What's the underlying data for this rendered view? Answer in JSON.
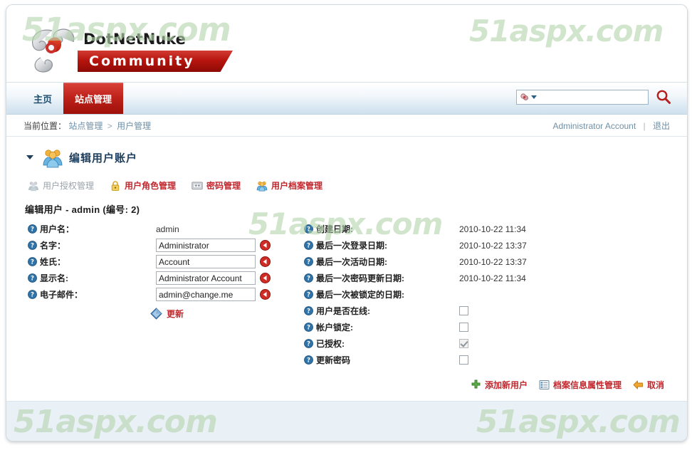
{
  "logo": {
    "line1": "DotNetNuke",
    "line2": "Community",
    "icon": "dnn-swirl-logo"
  },
  "watermarks": {
    "text": "51aspx.com",
    "color": "#b6d6b0"
  },
  "nav": {
    "tabs": [
      {
        "label": "主页",
        "active": false
      },
      {
        "label": "站点管理",
        "active": true
      }
    ]
  },
  "search": {
    "value": "",
    "placeholder": "",
    "provider_icon": "search-provider-icon",
    "dropdown_icon": "chevron-down-icon",
    "go_icon": "magnifier-icon"
  },
  "breadcrumb": {
    "label": "当前位置：",
    "items": [
      "站点管理",
      "用户管理"
    ],
    "separator": ">"
  },
  "account": {
    "name": "Administrator Account",
    "separator": "|",
    "logout": "退出"
  },
  "module": {
    "title": "编辑用户账户",
    "icon": "users-group-icon",
    "collapse_icon": "triangle-down-icon"
  },
  "tablinks": [
    {
      "label": "用户授权管理",
      "icon": "users-group-icon",
      "disabled": true
    },
    {
      "label": "用户角色管理",
      "icon": "lock-icon",
      "disabled": false
    },
    {
      "label": "密码管理",
      "icon": "password-asterisks-icon",
      "disabled": false
    },
    {
      "label": "用户档案管理",
      "icon": "users-group-icon",
      "disabled": false
    }
  ],
  "edit_heading": "编辑用户 - admin (编号: 2)",
  "left_fields": [
    {
      "label": "用户名：",
      "type": "text_static",
      "value": "admin"
    },
    {
      "label": "名字：",
      "type": "input",
      "value": "Administrator",
      "undo_icon": "undo-arrow-icon"
    },
    {
      "label": "姓氏：",
      "type": "input",
      "value": "Account",
      "undo_icon": "undo-arrow-icon"
    },
    {
      "label": "显示名:",
      "type": "input",
      "value": "Administrator Account",
      "undo_icon": "undo-arrow-icon"
    },
    {
      "label": "电子邮件：",
      "type": "input",
      "value": "admin@change.me",
      "undo_icon": "undo-arrow-icon"
    }
  ],
  "update": {
    "label": "更新",
    "icon": "save-disk-icon"
  },
  "right_fields": [
    {
      "label": "创建日期:",
      "type": "text_static",
      "value": "2010-10-22 11:34"
    },
    {
      "label": "最后一次登录日期:",
      "type": "text_static",
      "value": "2010-10-22 13:37"
    },
    {
      "label": "最后一次活动日期:",
      "type": "text_static",
      "value": "2010-10-22 13:37"
    },
    {
      "label": "最后一次密码更新日期:",
      "type": "text_static",
      "value": "2010-10-22 11:34"
    },
    {
      "label": "最后一次被锁定的日期:",
      "type": "text_static",
      "value": ""
    },
    {
      "label": "用户是否在线:",
      "type": "checkbox",
      "checked": false,
      "disabled": false
    },
    {
      "label": "帐户锁定:",
      "type": "checkbox",
      "checked": false,
      "disabled": false
    },
    {
      "label": "已授权:",
      "type": "checkbox",
      "checked": true,
      "disabled": true
    },
    {
      "label": "更新密码",
      "type": "checkbox",
      "checked": false,
      "disabled": false
    }
  ],
  "bottom_actions": [
    {
      "label": "添加新用户",
      "icon": "plus-green-icon"
    },
    {
      "label": "档案信息属性管理",
      "icon": "list-properties-icon"
    },
    {
      "label": "取消",
      "icon": "arrow-left-orange-icon"
    }
  ],
  "colors": {
    "brand_red": "#c1272d",
    "link_blue": "#6f8fa6",
    "title_blue": "#1f3f5c",
    "nav_active": "#c0231b",
    "footer_bg": "#e9f0f6"
  }
}
